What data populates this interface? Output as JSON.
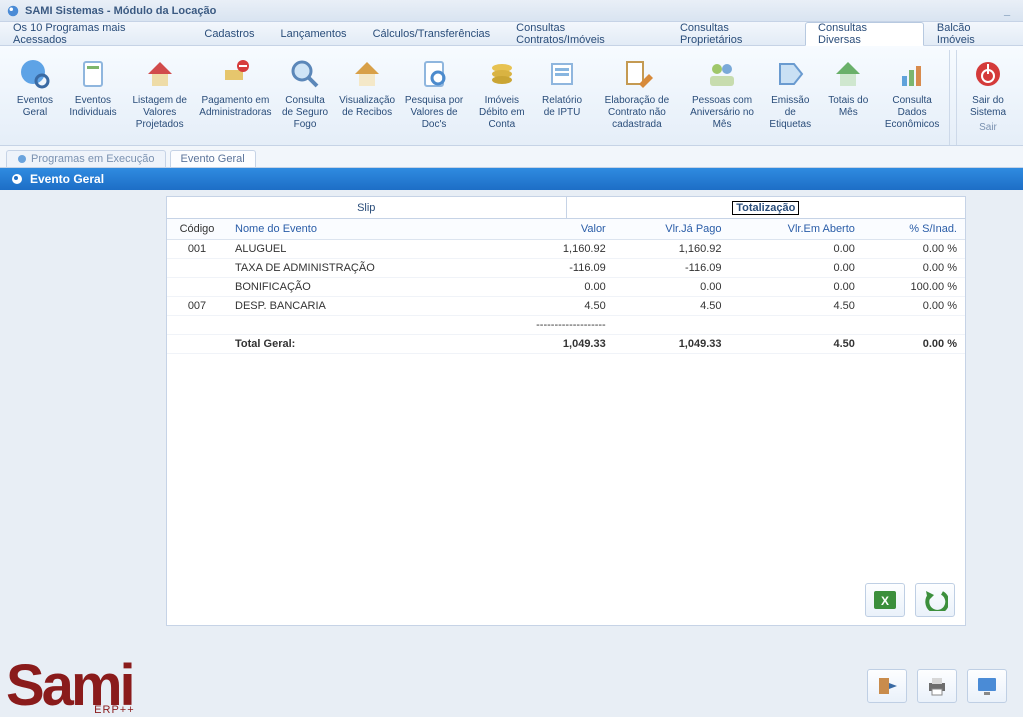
{
  "window": {
    "title": "SAMI Sistemas - Módulo da Locação"
  },
  "menu": {
    "items": [
      "Os 10 Programas mais Acessados",
      "Cadastros",
      "Lançamentos",
      "Cálculos/Transferências",
      "Consultas Contratos/Imóveis",
      "Consultas Proprietários",
      "Consultas Diversas",
      "Balcão Imóveis"
    ],
    "activeIndex": 6
  },
  "ribbon": {
    "buttons": [
      "Eventos Geral",
      "Eventos Individuais",
      "Listagem de Valores Projetados",
      "Pagamento em Administradoras",
      "Consulta de Seguro Fogo",
      "Visualização de Recibos",
      "Pesquisa por Valores de Doc's",
      "Imóveis Débito em Conta",
      "Relatório de IPTU",
      "Elaboração de Contrato não cadastrada",
      "Pessoas com Aniversário no Mês",
      "Emissão de Etiquetas",
      "Totais do Mês",
      "Consulta Dados Econômicos"
    ],
    "exit": "Sair do Sistema",
    "exitCaption": "Sair"
  },
  "doctabs": {
    "items": [
      "Programas em Execução",
      "Evento Geral"
    ],
    "activeIndex": 1
  },
  "child": {
    "title": "Evento Geral"
  },
  "innerTabs": {
    "items": [
      "Slip",
      "Totalização"
    ],
    "activeIndex": 1
  },
  "grid": {
    "columns": [
      "Código",
      "Nome do Evento",
      "Valor",
      "Vlr.Já Pago",
      "Vlr.Em Aberto",
      "% S/Inad."
    ],
    "rows": [
      {
        "code": "001",
        "name": "ALUGUEL",
        "valor": "1,160.92",
        "pago": "1,160.92",
        "aberto": "0.00",
        "inad": "0.00 %"
      },
      {
        "code": "",
        "name": "TAXA DE ADMINISTRAÇÃO",
        "valor": "-116.09",
        "pago": "-116.09",
        "aberto": "0.00",
        "inad": "0.00 %"
      },
      {
        "code": "",
        "name": "BONIFICAÇÃO",
        "valor": "0.00",
        "pago": "0.00",
        "aberto": "0.00",
        "inad": "100.00 %"
      },
      {
        "code": "007",
        "name": "DESP. BANCARIA",
        "valor": "4.50",
        "pago": "4.50",
        "aberto": "4.50",
        "inad": "0.00 %"
      }
    ],
    "separator": "-------------------",
    "total": {
      "label": "Total Geral:",
      "valor": "1,049.33",
      "pago": "1,049.33",
      "aberto": "4.50",
      "inad": "0.00 %"
    }
  },
  "logo": {
    "text": "Sami",
    "sub": "ERP++"
  }
}
